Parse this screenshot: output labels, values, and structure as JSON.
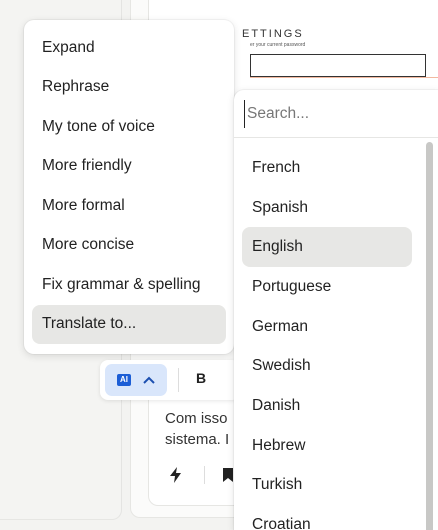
{
  "background": {
    "settings_title": "ETTINGS",
    "settings_subtitle": "er your current password",
    "body_text": "Com isso\nsistema. I"
  },
  "ai_menu": {
    "items": [
      {
        "label": "Expand"
      },
      {
        "label": "Rephrase"
      },
      {
        "label": "My tone of voice"
      },
      {
        "label": "More friendly"
      },
      {
        "label": "More formal"
      },
      {
        "label": "More concise"
      },
      {
        "label": "Fix grammar & spelling"
      },
      {
        "label": "Translate to...",
        "selected": true
      }
    ]
  },
  "toolbar": {
    "ai_badge": "AI",
    "ai_chevron_icon": "chevron-up-icon",
    "bold_label": "B"
  },
  "language_menu": {
    "search_placeholder": "Search...",
    "search_value": "",
    "languages": [
      {
        "label": "French"
      },
      {
        "label": "Spanish"
      },
      {
        "label": "English",
        "selected": true
      },
      {
        "label": "Portuguese"
      },
      {
        "label": "German"
      },
      {
        "label": "Swedish"
      },
      {
        "label": "Danish"
      },
      {
        "label": "Hebrew"
      },
      {
        "label": "Turkish"
      },
      {
        "label": "Croatian"
      }
    ]
  },
  "colors": {
    "accent": "#1c5ed6",
    "ai_button_bg": "#d9e6fb",
    "selected_bg": "#e7e7e5"
  }
}
